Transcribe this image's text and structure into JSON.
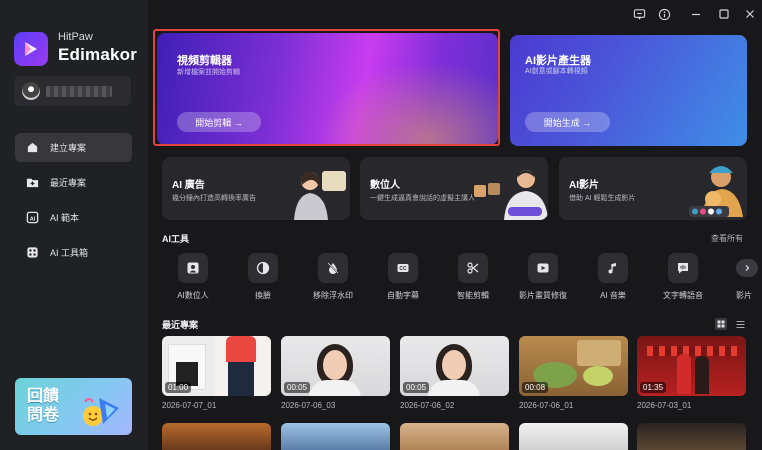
{
  "app": {
    "brand_small": "HitPaw",
    "brand_big": "Edimakor"
  },
  "sidebar": {
    "items": [
      {
        "label": "建立專案",
        "icon": "home-icon",
        "active": true
      },
      {
        "label": "最近專案",
        "icon": "folder-icon",
        "active": false
      },
      {
        "label": "AI 範本",
        "icon": "ai-template-icon",
        "active": false
      },
      {
        "label": "AI 工具箱",
        "icon": "toolbox-icon",
        "active": false
      }
    ],
    "promo": {
      "line1": "回饋",
      "line2": "問卷"
    }
  },
  "window_controls": [
    "chat-icon",
    "info-icon",
    "minimize-icon",
    "maximize-icon",
    "close-icon"
  ],
  "hero": [
    {
      "title": "視頻剪輯器",
      "subtitle": "新增檔案並開始剪輯",
      "button": "開始剪輯 →"
    },
    {
      "title": "AI影片產生器",
      "subtitle": "AI創意或腳本轉視頻",
      "button": "開始生成 →"
    }
  ],
  "cards": [
    {
      "title": "AI 廣告",
      "subtitle": "幾分鐘內打造高轉換率廣告"
    },
    {
      "title": "數位人",
      "subtitle": "一鍵生成逼真會說話的虛擬主講人"
    },
    {
      "title": "AI影片",
      "subtitle": "借助 AI 輕鬆生成影片"
    }
  ],
  "ai_tools": {
    "title": "AI工具",
    "view_all": "查看所有",
    "items": [
      {
        "label": "AI數位人",
        "icon": "avatar-icon"
      },
      {
        "label": "換臉",
        "icon": "face-swap-icon"
      },
      {
        "label": "移除浮水印",
        "icon": "watermark-remove-icon"
      },
      {
        "label": "自動字幕",
        "icon": "cc-icon"
      },
      {
        "label": "智能剪輯",
        "icon": "smart-cut-icon"
      },
      {
        "label": "影片畫質修復",
        "icon": "enhance-icon"
      },
      {
        "label": "AI 音樂",
        "icon": "music-icon"
      },
      {
        "label": "文字轉語音",
        "icon": "tts-icon"
      },
      {
        "label": "影片",
        "icon": "video-icon"
      }
    ]
  },
  "recent": {
    "title": "最近專案",
    "items": [
      {
        "duration": "01:00",
        "date": "2026-07-07_01"
      },
      {
        "duration": "00:05",
        "date": "2026-07-06_03"
      },
      {
        "duration": "00:05",
        "date": "2026-07-06_02"
      },
      {
        "duration": "00:08",
        "date": "2026-07-06_01"
      },
      {
        "duration": "01:35",
        "date": "2026-07-03_01"
      }
    ]
  }
}
